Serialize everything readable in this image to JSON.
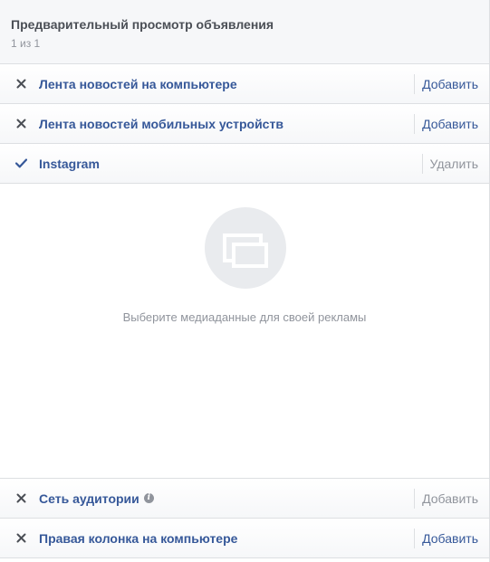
{
  "header": {
    "title": "Предварительный просмотр объявления",
    "counter": "1 из 1"
  },
  "placements": [
    {
      "label": "Лента новостей на компьютере",
      "state": "off",
      "icon": "close-icon",
      "action": "Добавить",
      "action_enabled": true
    },
    {
      "label": "Лента новостей мобильных устройств",
      "state": "off",
      "icon": "close-icon",
      "action": "Добавить",
      "action_enabled": true
    },
    {
      "label": "Instagram",
      "state": "on",
      "icon": "checkmark-icon",
      "action": "Удалить",
      "action_enabled": false
    }
  ],
  "preview": {
    "icon": "media-placeholder-icon",
    "message": "Выберите медиаданные для своей рекламы"
  },
  "bottom_placements": [
    {
      "label": "Сеть аудитории",
      "state": "off",
      "icon": "close-icon",
      "info": true,
      "action": "Добавить",
      "action_enabled": false
    },
    {
      "label": "Правая колонка на компьютере",
      "state": "off",
      "icon": "close-icon",
      "action": "Добавить",
      "action_enabled": true
    }
  ],
  "colors": {
    "link": "#365899",
    "muted": "#90949c",
    "border": "#dddfe2",
    "icon": "#4b4f56"
  }
}
